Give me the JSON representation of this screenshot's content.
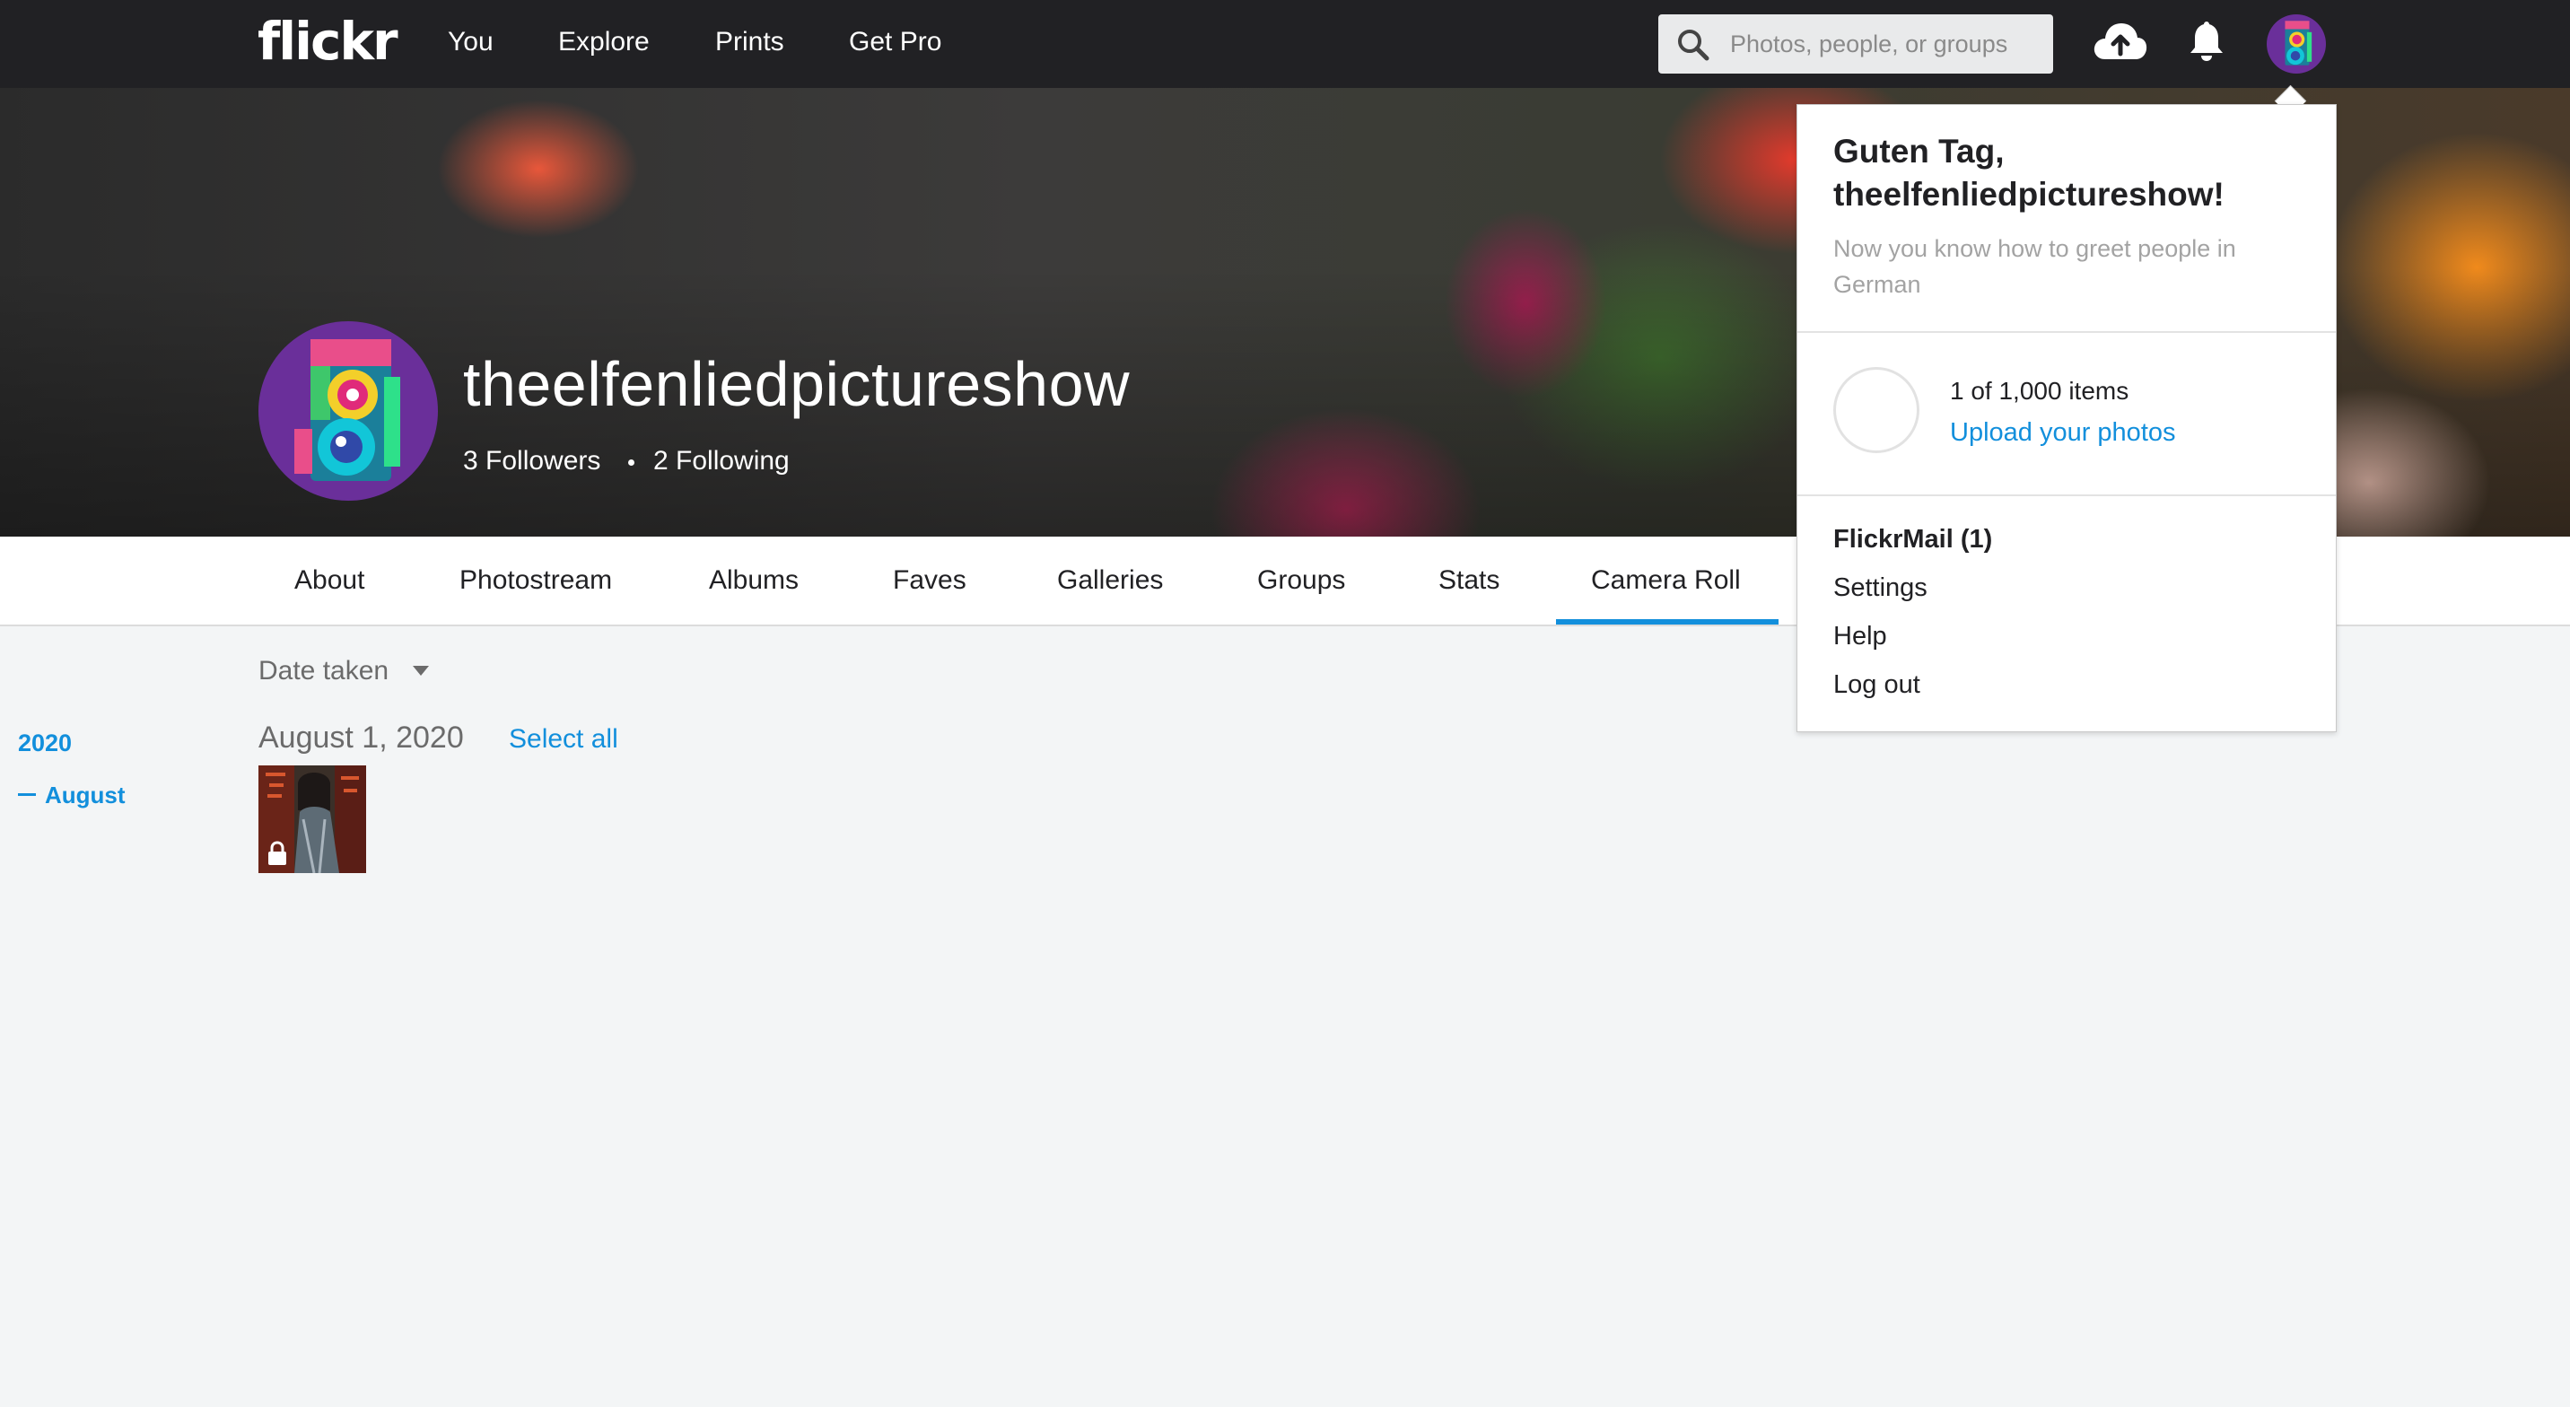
{
  "topbar": {
    "logo": "flickr",
    "nav": [
      "You",
      "Explore",
      "Prints",
      "Get Pro"
    ],
    "search_placeholder": "Photos, people, or groups",
    "icons": [
      "search-icon",
      "upload-cloud-icon",
      "bell-icon",
      "avatar"
    ]
  },
  "profile": {
    "username": "theelfenliedpictureshow",
    "followers": "3 Followers",
    "following": "2 Following"
  },
  "tabs": {
    "items": [
      "About",
      "Photostream",
      "Albums",
      "Faves",
      "Galleries",
      "Groups",
      "Stats",
      "Camera Roll"
    ],
    "active": "Camera Roll"
  },
  "camera_roll": {
    "sort_label": "Date taken",
    "timeline_year": "2020",
    "timeline_month": "August",
    "date_heading": "August 1, 2020",
    "select_all": "Select all"
  },
  "dropdown": {
    "greeting": "Guten Tag, theelfenliedpictureshow!",
    "greeting_sub": "Now you know how to greet people in German",
    "items_count": "1 of 1,000 items",
    "upload_link": "Upload your photos",
    "menu": [
      "FlickrMail (1)",
      "Settings",
      "Help",
      "Log out"
    ]
  },
  "colors": {
    "topbar": "#212124",
    "accent": "#128fdc",
    "page_bg": "#f3f5f6"
  }
}
